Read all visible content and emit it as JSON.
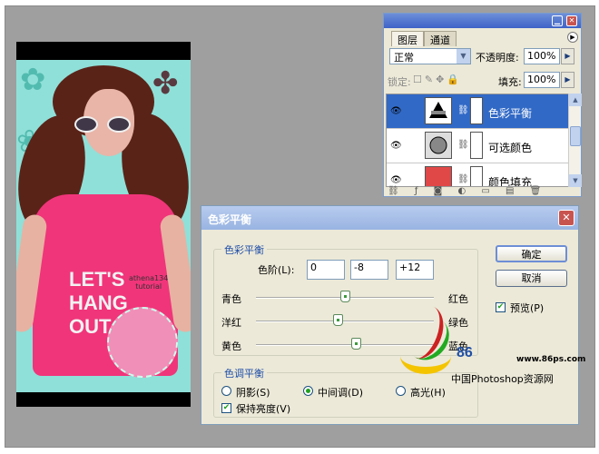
{
  "photo": {
    "shirt_text": [
      "LET'S",
      "HANG",
      "OUT"
    ],
    "watermark": "athena134\ntutorial"
  },
  "layers_panel": {
    "tabs": [
      {
        "label": "图层"
      },
      {
        "label": "通道"
      }
    ],
    "blend_mode": "正常",
    "opacity_label": "不透明度:",
    "opacity_value": "100%",
    "lock_label": "锁定:",
    "fill_label": "填充:",
    "fill_value": "100%",
    "layers": [
      {
        "name": "色彩平衡",
        "selected": true,
        "visible": true,
        "mask": "white"
      },
      {
        "name": "可选颜色",
        "selected": false,
        "visible": true,
        "mask": "white"
      },
      {
        "name": "颜色填充",
        "selected": false,
        "visible": true,
        "mask": "white",
        "fill_color": "#e04848"
      }
    ]
  },
  "dialog": {
    "title": "色彩平衡",
    "close_icon": "close-icon",
    "color_balance_group": "色彩平衡",
    "levels_label": "色阶(L):",
    "levels": [
      "0",
      "-8",
      "+12"
    ],
    "sliders": [
      {
        "left": "青色",
        "right": "红色",
        "value": 0
      },
      {
        "left": "洋红",
        "right": "绿色",
        "value": -8
      },
      {
        "left": "黄色",
        "right": "蓝色",
        "value": 12
      }
    ],
    "tone_group": "色调平衡",
    "tones": [
      {
        "label": "阴影(S)",
        "checked": false
      },
      {
        "label": "中间调(D)",
        "checked": true
      },
      {
        "label": "高光(H)",
        "checked": false
      }
    ],
    "preserve_luminosity": "保持亮度(V)",
    "preserve_checked": true,
    "ok": "确定",
    "cancel": "取消",
    "preview": "预览(P)",
    "preview_checked": true
  },
  "logo": {
    "number": "86",
    "url": "www.86ps.com",
    "site": "中国Photoshop资源网"
  },
  "colors": {
    "selection": "#3169c6",
    "dialog_bg": "#ece9d8",
    "panel_title": "#3e63c7",
    "background": "#9f9f9f"
  }
}
